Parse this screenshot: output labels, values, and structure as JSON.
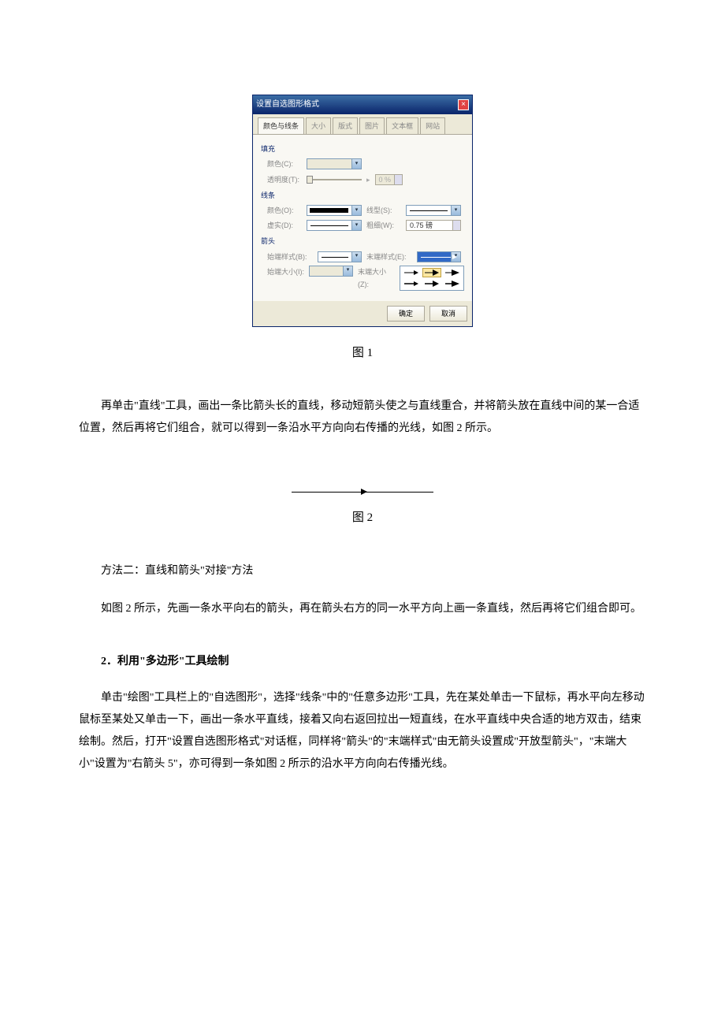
{
  "dialog": {
    "title": "设置自选图形格式",
    "tabs": [
      "颜色与线条",
      "大小",
      "版式",
      "图片",
      "文本框",
      "网站"
    ],
    "sections": {
      "fill_label": "填充",
      "fill_color_label": "颜色(C):",
      "transparency_label": "透明度(T):",
      "transparency_value": "0 %",
      "line_label": "线条",
      "line_color_label": "颜色(O):",
      "line_style_label": "线型(S):",
      "dash_label": "虚实(D):",
      "weight_label": "粗细(W):",
      "weight_value": "0.75 磅",
      "arrow_label": "箭头",
      "begin_style_label": "始端样式(B):",
      "end_style_label": "末端样式(E):",
      "begin_size_label": "始端大小(I):",
      "end_size_label": "末端大小(Z):"
    },
    "buttons": {
      "ok": "确定",
      "cancel": "取消"
    }
  },
  "captions": {
    "fig1": "图 1",
    "fig2": "图 2"
  },
  "paragraphs": {
    "p1": "再单击\"直线\"工具，画出一条比箭头长的直线，移动短箭头使之与直线重合，并将箭头放在直线中间的某一合适位置，然后再将它们组合，就可以得到一条沿水平方向向右传播的光线，如图 2 所示。",
    "p2": "方法二：直线和箭头\"对接\"方法",
    "p3": "如图 2 所示，先画一条水平向右的箭头，再在箭头右方的同一水平方向上画一条直线，然后再将它们组合即可。",
    "section2": "2．利用\"多边形\"工具绘制",
    "p4": "单击\"绘图\"工具栏上的\"自选图形\"，选择\"线条\"中的\"任意多边形\"工具，先在某处单击一下鼠标，再水平向左移动鼠标至某处又单击一下，画出一条水平直线，接着又向右返回拉出一短直线，在水平直线中央合适的地方双击，结束绘制。然后，打开\"设置自选图形格式\"对话框，同样将\"箭头\"的\"末端样式\"由无箭头设置成\"开放型箭头\"，\"末端大小\"设置为\"右箭头 5\"，亦可得到一条如图 2 所示的沿水平方向向右传播光线。"
  }
}
